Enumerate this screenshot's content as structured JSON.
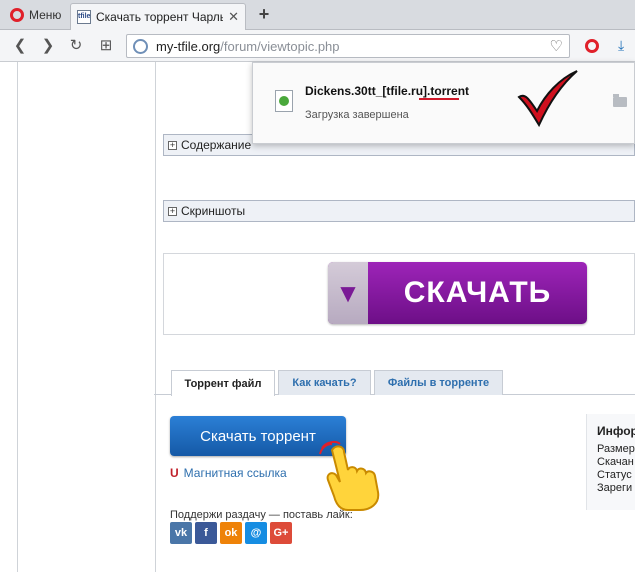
{
  "browser": {
    "menu_label": "Меню",
    "tab": {
      "favicon_text": "tfile",
      "title": "Скачать торрент Чарльз /"
    },
    "new_tab": "+",
    "address": {
      "host": "my-tfile.org",
      "path": "/forum/viewtopic.php"
    }
  },
  "downloads_popup": {
    "filename": "Dickens.30tt_[tfile.ru].torrent",
    "status": "Загрузка завершена"
  },
  "page": {
    "spoilers": [
      {
        "label": "Содержание"
      },
      {
        "label": "Скриншоты"
      }
    ],
    "download_banner": "СКАЧАТЬ",
    "tabs": [
      {
        "label": "Торрент файл",
        "active": true
      },
      {
        "label": "Как качать?",
        "active": false
      },
      {
        "label": "Файлы в торренте",
        "active": false
      }
    ],
    "download_torrent_label": "Скачать торрент",
    "magnet_label": "Магнитная ссылка",
    "support_text": "Поддержи раздачу — поставь лайк:",
    "social": [
      {
        "name": "vk-icon",
        "glyph": "vk",
        "color": "#4a76a8"
      },
      {
        "name": "facebook-icon",
        "glyph": "f",
        "color": "#3b5998"
      },
      {
        "name": "odnoklassniki-icon",
        "glyph": "ok",
        "color": "#ee8208"
      },
      {
        "name": "moimir-icon",
        "glyph": "@",
        "color": "#168de2"
      },
      {
        "name": "googleplus-icon",
        "glyph": "G+",
        "color": "#dd4b39"
      }
    ],
    "info": {
      "title": "Инфор",
      "lines": [
        "Размер",
        "Скачан",
        "Статус",
        "Зареги"
      ]
    }
  }
}
